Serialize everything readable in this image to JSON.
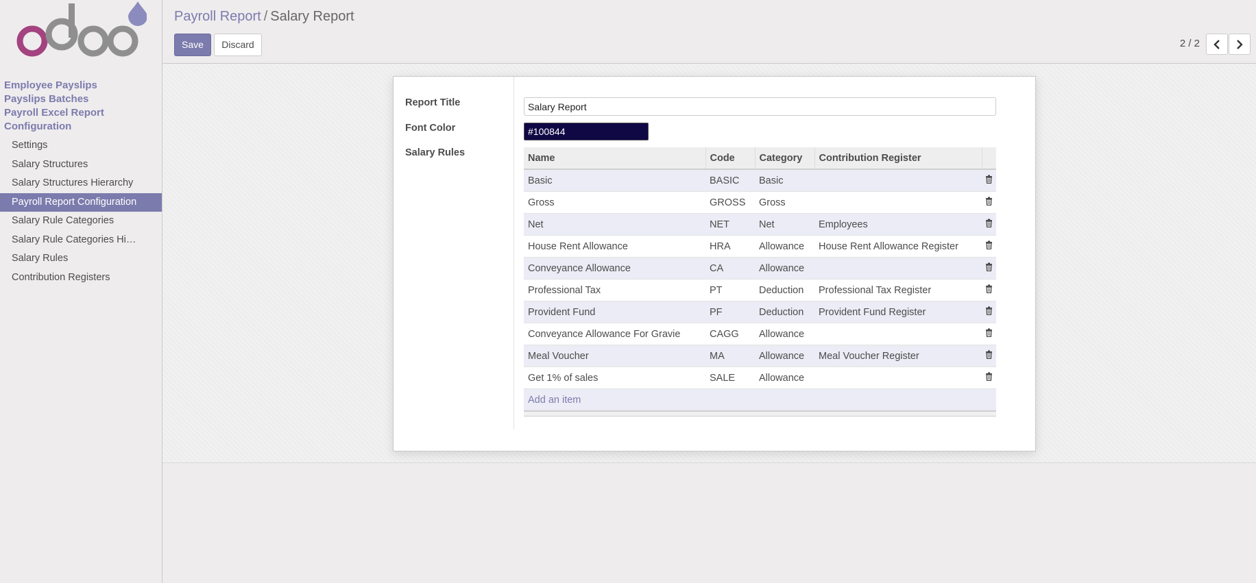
{
  "app": {
    "menu_headers": [
      "Employee Payslips",
      "Payslips Batches",
      "Payroll Excel Report",
      "Configuration"
    ],
    "menu_items": [
      {
        "label": "Settings",
        "active": false
      },
      {
        "label": "Salary Structures",
        "active": false
      },
      {
        "label": "Salary Structures Hierarchy",
        "active": false
      },
      {
        "label": "Payroll Report Configuration",
        "active": true
      },
      {
        "label": "Salary Rule Categories",
        "active": false
      },
      {
        "label": "Salary Rule Categories Hi…",
        "active": false
      },
      {
        "label": "Salary Rules",
        "active": false
      },
      {
        "label": "Contribution Registers",
        "active": false
      }
    ]
  },
  "breadcrumb": {
    "parent": "Payroll Report",
    "separator": "/",
    "current": "Salary Report"
  },
  "toolbar": {
    "save_label": "Save",
    "discard_label": "Discard"
  },
  "pager": {
    "text": "2 / 2"
  },
  "form": {
    "report_title_label": "Report Title",
    "report_title_value": "Salary Report",
    "font_color_label": "Font Color",
    "font_color_value": "#100844",
    "salary_rules_label": "Salary Rules",
    "table": {
      "columns": [
        "Name",
        "Code",
        "Category",
        "Contribution Register"
      ],
      "rows": [
        [
          "Basic",
          "BASIC",
          "Basic",
          ""
        ],
        [
          "Gross",
          "GROSS",
          "Gross",
          ""
        ],
        [
          "Net",
          "NET",
          "Net",
          "Employees"
        ],
        [
          "House Rent Allowance",
          "HRA",
          "Allowance",
          "House Rent Allowance Register"
        ],
        [
          "Conveyance Allowance",
          "CA",
          "Allowance",
          ""
        ],
        [
          "Professional Tax",
          "PT",
          "Deduction",
          "Professional Tax Register"
        ],
        [
          "Provident Fund",
          "PF",
          "Deduction",
          "Provident Fund Register"
        ],
        [
          "Conveyance Allowance For Gravie",
          "CAGG",
          "Allowance",
          ""
        ],
        [
          "Meal Voucher",
          "MA",
          "Allowance",
          "Meal Voucher Register"
        ],
        [
          "Get 1% of sales",
          "SALE",
          "Allowance",
          ""
        ]
      ],
      "add_item_label": "Add an item"
    }
  },
  "colors": {
    "accent": "#7c7bad",
    "logo_pink": "#a3437f",
    "logo_gray": "#8f8f8f"
  },
  "icons": {
    "row_delete": "trash-icon",
    "prev": "chevron-left-icon",
    "next": "chevron-right-icon"
  }
}
